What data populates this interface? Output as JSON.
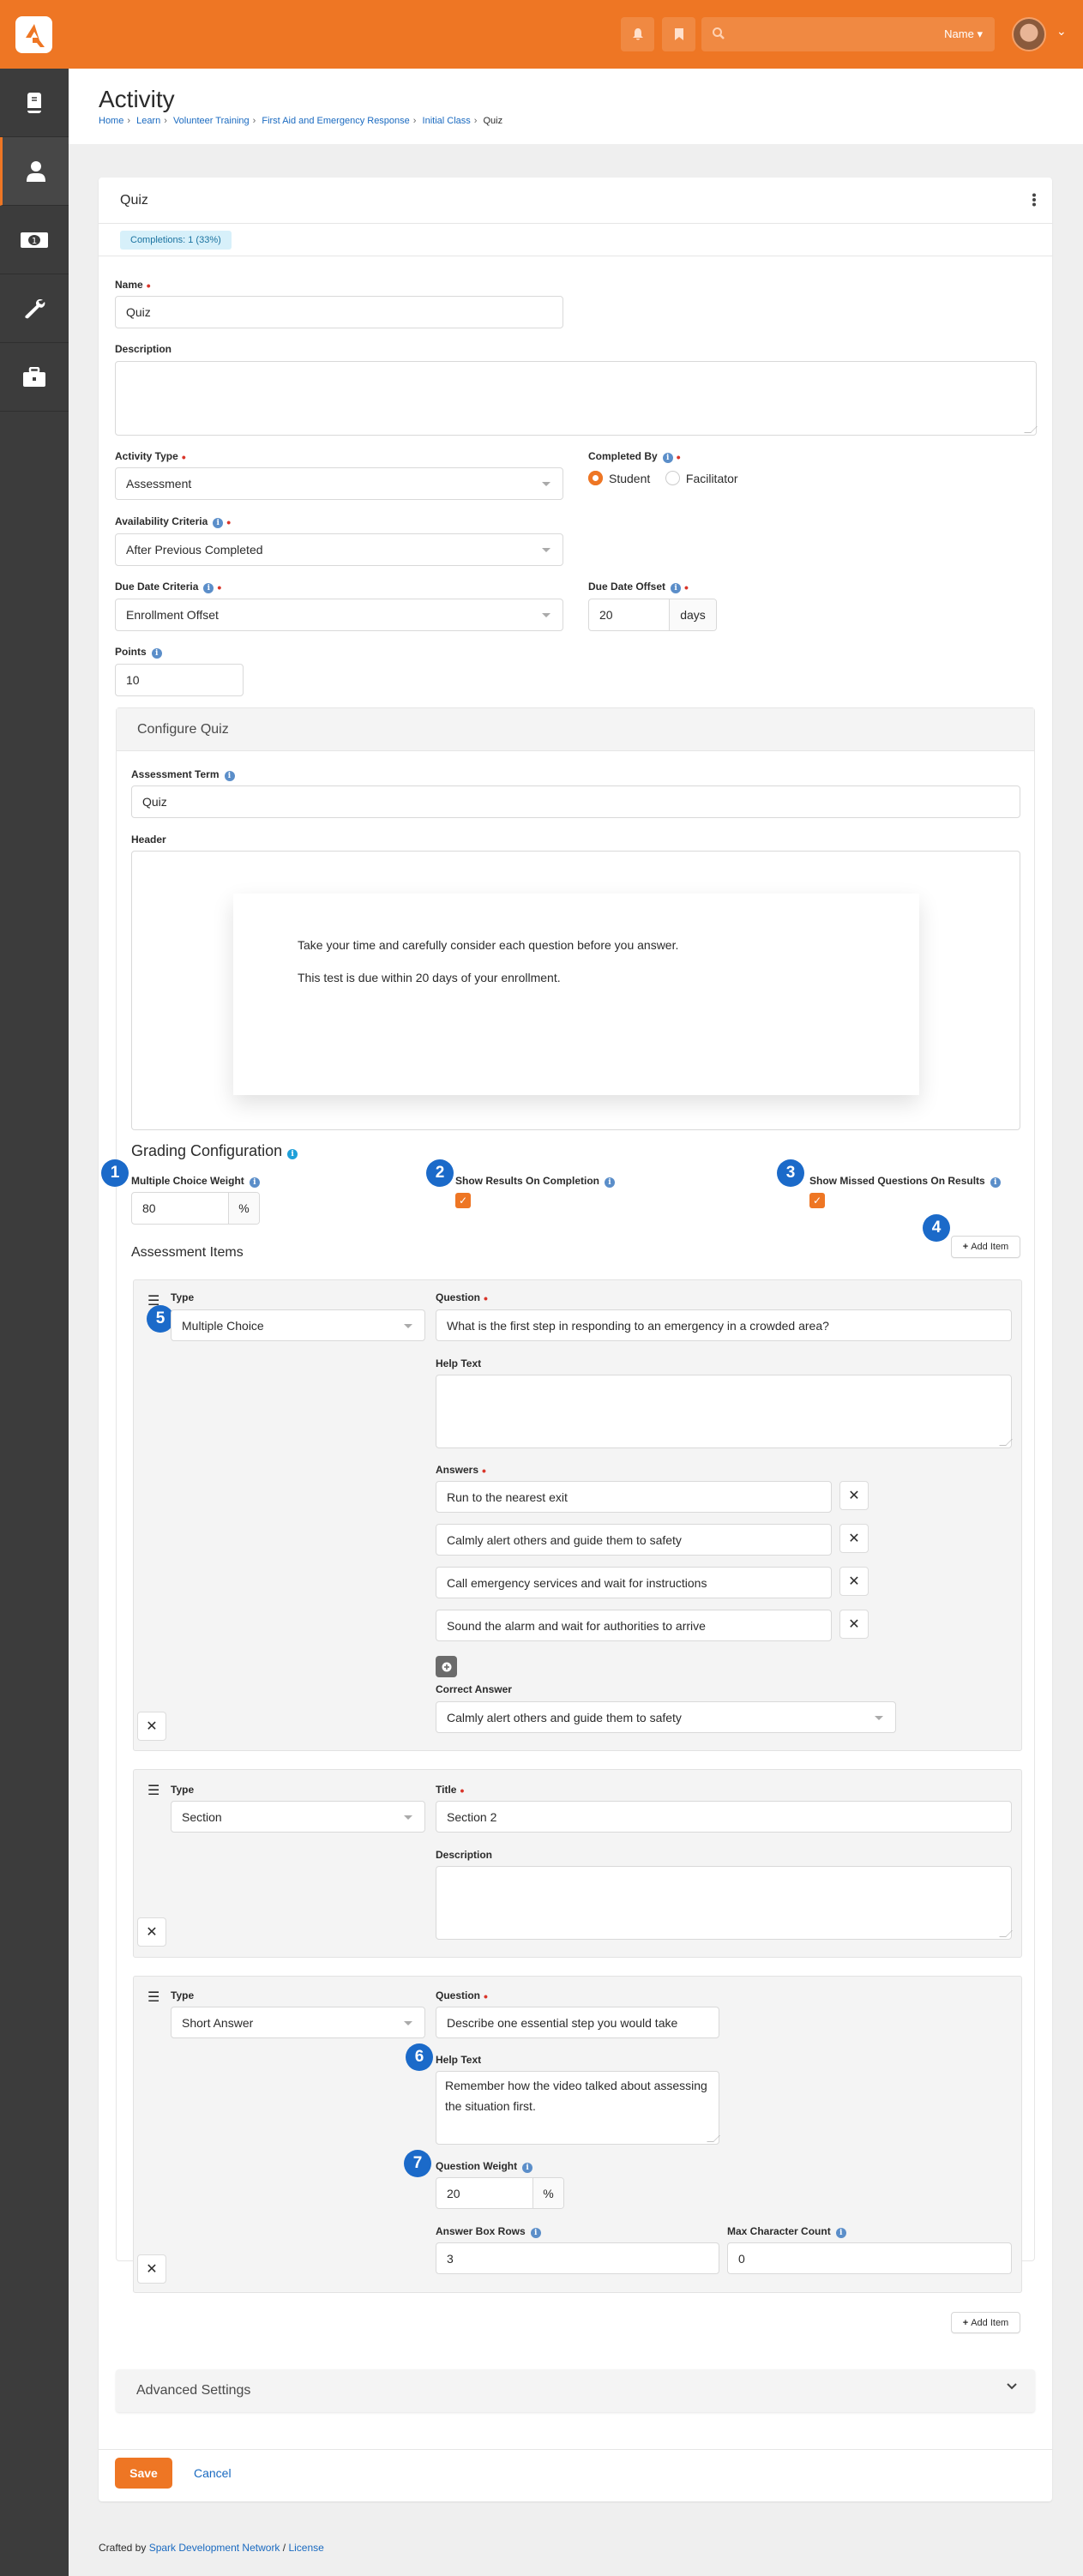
{
  "topbar": {
    "search_placeholder": "",
    "search_scope": "Name",
    "icons": [
      "bell-icon",
      "bookmark-icon",
      "search-icon"
    ]
  },
  "sidebar": {
    "items": [
      {
        "icon": "book-icon",
        "active": false
      },
      {
        "icon": "person-icon",
        "active": true
      },
      {
        "icon": "money-icon",
        "active": false
      },
      {
        "icon": "wrench-icon",
        "active": false
      },
      {
        "icon": "briefcase-icon",
        "active": false
      }
    ]
  },
  "page": {
    "title": "Activity",
    "breadcrumb": [
      "Home",
      "Learn",
      "Volunteer Training",
      "First Aid and Emergency Response",
      "Initial Class",
      "Quiz"
    ]
  },
  "panel": {
    "title": "Quiz",
    "completions_badge": "Completions: 1 (33%)"
  },
  "form": {
    "name_label": "Name",
    "name_value": "Quiz",
    "description_label": "Description",
    "description_value": "",
    "activity_type_label": "Activity Type",
    "activity_type_value": "Assessment",
    "completed_by_label": "Completed By",
    "completed_by_options": [
      "Student",
      "Facilitator"
    ],
    "completed_by_selected": "Student",
    "availability_label": "Availability Criteria",
    "availability_value": "After Previous Completed",
    "due_date_criteria_label": "Due Date Criteria",
    "due_date_criteria_value": "Enrollment Offset",
    "due_date_offset_label": "Due Date Offset",
    "due_date_offset_value": "20",
    "due_date_offset_unit": "days",
    "points_label": "Points",
    "points_value": "10"
  },
  "configure": {
    "title": "Configure Quiz",
    "assessment_term_label": "Assessment Term",
    "assessment_term_value": "Quiz",
    "header_label": "Header",
    "header_lines": [
      "Take your time and carefully consider each question before you answer.",
      "This test is due within 20 days of your enrollment."
    ],
    "grading_title": "Grading Configuration",
    "mc_weight_label": "Multiple Choice Weight",
    "mc_weight_value": "80",
    "percent_unit": "%",
    "show_results_label": "Show Results On Completion",
    "show_results_checked": true,
    "show_missed_label": "Show Missed Questions On Results",
    "show_missed_checked": true,
    "assessment_items_title": "Assessment Items",
    "add_item_label": "Add Item",
    "callouts": [
      "1",
      "2",
      "3",
      "4",
      "5",
      "6",
      "7"
    ]
  },
  "items": [
    {
      "type_label": "Type",
      "type_value": "Multiple Choice",
      "question_label": "Question",
      "question_value": "What is the first step in responding to an emergency in a crowded area?",
      "help_label": "Help Text",
      "help_value": "",
      "answers_label": "Answers",
      "answers": [
        "Run to the nearest exit",
        "Calmly alert others and guide them to safety",
        "Call emergency services and wait for instructions",
        "Sound the alarm and wait for authorities to arrive"
      ],
      "correct_label": "Correct Answer",
      "correct_value": "Calmly alert others and guide them to safety"
    },
    {
      "type_label": "Type",
      "type_value": "Section",
      "title_label": "Title",
      "title_value": "Section 2",
      "description_label": "Description",
      "description_value": ""
    },
    {
      "type_label": "Type",
      "type_value": "Short Answer",
      "question_label": "Question",
      "question_value": "Describe one essential step you would take",
      "help_label": "Help Text",
      "help_value": "Remember how the video talked about assessing the situation first.",
      "weight_label": "Question Weight",
      "weight_value": "20",
      "rows_label": "Answer Box Rows",
      "rows_value": "3",
      "max_chars_label": "Max Character Count",
      "max_chars_value": "0"
    }
  ],
  "advanced": {
    "title": "Advanced Settings"
  },
  "actions": {
    "save": "Save",
    "cancel": "Cancel"
  },
  "footer": {
    "prefix": "Crafted by",
    "org": "Spark Development Network",
    "sep": "/",
    "license": "License"
  },
  "colors": {
    "brand": "#ee7624",
    "link": "#1a6ac0",
    "callout": "#1b6ac9",
    "sidebar": "#3c3c3c"
  }
}
